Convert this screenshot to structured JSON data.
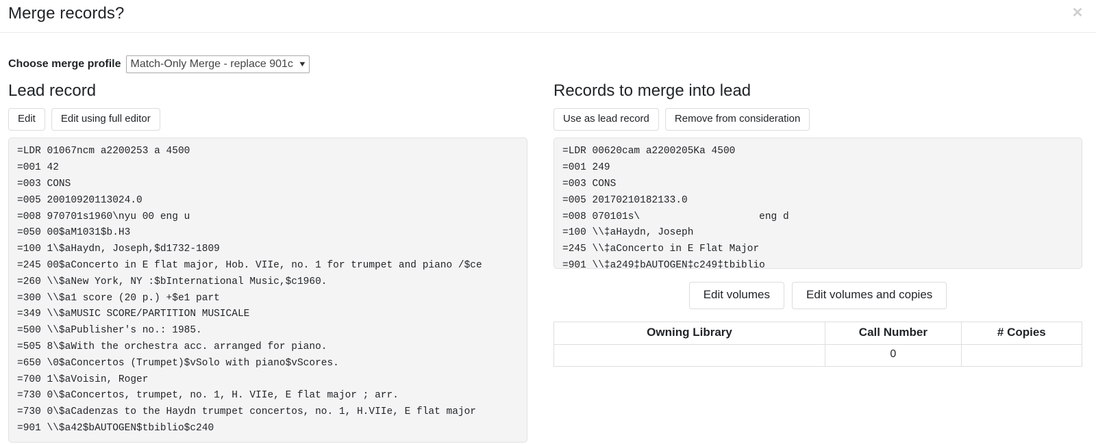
{
  "modal": {
    "title": "Merge records?",
    "close_icon": "close-icon",
    "close_glyph": "✕"
  },
  "merge_profile": {
    "label": "Choose merge profile",
    "selected": "Match-Only Merge - replace 901c",
    "caret_glyph": "▼",
    "options": [
      "Match-Only Merge - replace 901c"
    ]
  },
  "lead_record": {
    "heading": "Lead record",
    "buttons": [
      {
        "label": "Edit",
        "name": "edit-button"
      },
      {
        "label": "Edit using full editor",
        "name": "edit-full-editor-button"
      }
    ],
    "marc_lines": [
      "=LDR 01067ncm a2200253 a 4500",
      "=001 42",
      "=003 CONS",
      "=005 20010920113024.0",
      "=008 970701s1960\\nyu 00 eng u",
      "=050 00$aM1031$b.H3",
      "=100 1\\$aHaydn, Joseph,$d1732-1809",
      "=245 00$aConcerto in E flat major, Hob. VIIe, no. 1 for trumpet and piano /$ce",
      "=260 \\\\$aNew York, NY :$bInternational Music,$c1960.",
      "=300 \\\\$a1 score (20 p.) +$e1 part",
      "=349 \\\\$aMUSIC SCORE/PARTITION MUSICALE",
      "=500 \\\\$aPublisher's no.: 1985.",
      "=505 8\\$aWith the orchestra acc. arranged for piano.",
      "=650 \\0$aConcertos (Trumpet)$vSolo with piano$vScores.",
      "=700 1\\$aVoisin, Roger",
      "=730 0\\$aConcertos, trumpet, no. 1, H. VIIe, E flat major ; arr.",
      "=730 0\\$aCadenzas to the Haydn trumpet concertos, no. 1, H.VIIe, E flat major",
      "=901 \\\\$a42$bAUTOGEN$tbiblio$c240"
    ]
  },
  "merge_records": {
    "heading": "Records to merge into lead",
    "buttons": [
      {
        "label": "Use as lead record",
        "name": "use-as-lead-record-button"
      },
      {
        "label": "Remove from consideration",
        "name": "remove-from-consideration-button"
      }
    ],
    "marc_lines": [
      "=LDR 00620cam a2200205Ka 4500",
      "=001 249",
      "=003 CONS",
      "=005 20170210182133.0",
      "=008 070101s\\                    eng d",
      "=100 \\\\‡aHaydn, Joseph",
      "=245 \\\\‡aConcerto in E Flat Major",
      "=901 \\\\‡a249‡bAUTOGEN‡c249‡tbiblio"
    ],
    "volume_buttons": [
      {
        "label": "Edit volumes",
        "name": "edit-volumes-button"
      },
      {
        "label": "Edit volumes and copies",
        "name": "edit-volumes-and-copies-button"
      }
    ],
    "copies_table": {
      "headers": [
        "Owning Library",
        "Call Number",
        "# Copies"
      ],
      "rows": [
        {
          "owning_library": "",
          "call_number": "0",
          "copies": ""
        }
      ]
    }
  },
  "colors": {
    "background": "#ffffff",
    "pane_background": "#f4f4f4",
    "border": "#dedede",
    "text": "#212529",
    "close_icon": "#cfcfcf"
  }
}
